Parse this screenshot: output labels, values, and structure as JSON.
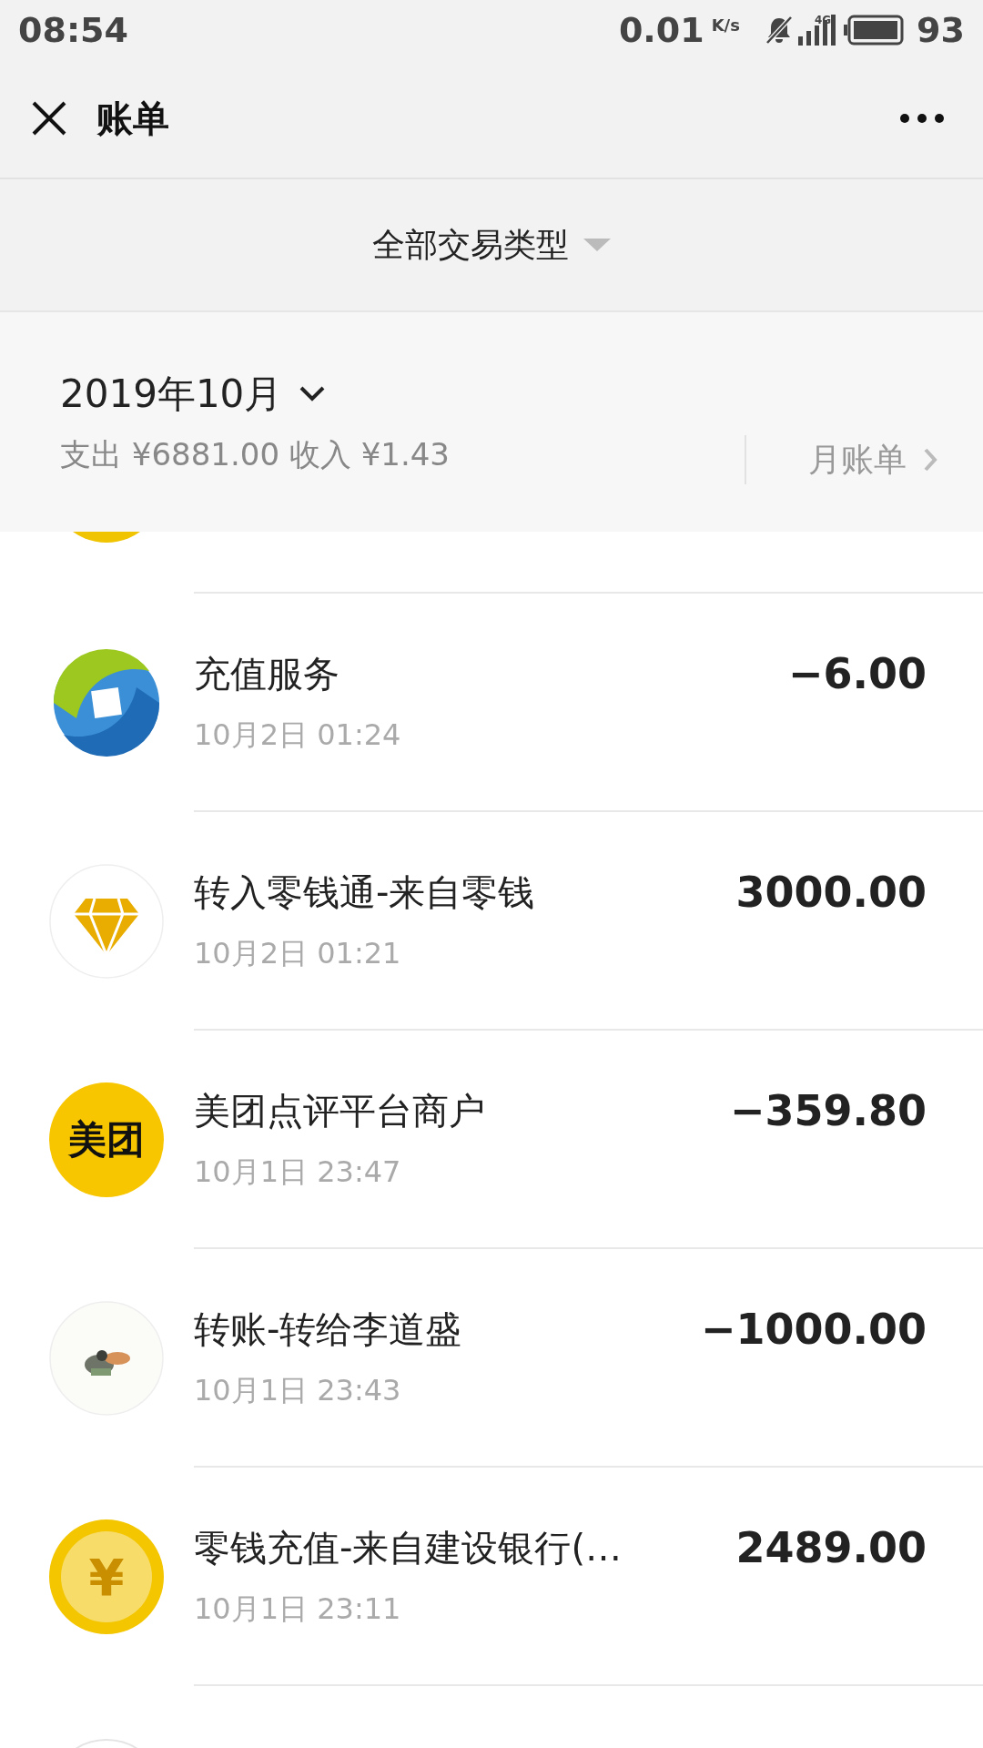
{
  "status_bar": {
    "time": "08:54",
    "speed": "0.01",
    "speed_unit": "K/s",
    "network": "4G",
    "battery": "93"
  },
  "nav": {
    "title": "账单"
  },
  "filter": {
    "label": "全部交易类型"
  },
  "month": {
    "title": "2019年10月",
    "summary": "支出 ¥6881.00 收入 ¥1.43",
    "bill_link": "月账单"
  },
  "transactions": [
    {
      "kind": "recharge",
      "title": "充值服务",
      "time": "10月2日 01:24",
      "amount": "−6.00"
    },
    {
      "kind": "diamond",
      "title": "转入零钱通-来自零钱",
      "time": "10月2日 01:21",
      "amount": "3000.00"
    },
    {
      "kind": "logo",
      "icon_text": "美团",
      "title": "美团点评平台商户",
      "time": "10月1日 23:47",
      "amount": "−359.80"
    },
    {
      "title": "转账-转给李道盛",
      "time": "10月1日 23:43",
      "amount": "−1000.00"
    },
    {
      "kind": "coin",
      "icon_text": "¥",
      "title": "零钱充值-来自建设银行(…",
      "time": "10月1日 23:11",
      "amount": "2489.00"
    }
  ]
}
